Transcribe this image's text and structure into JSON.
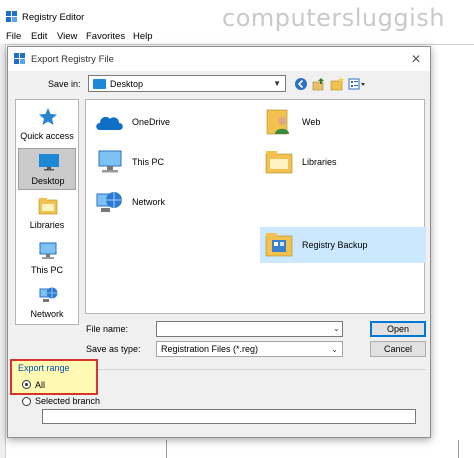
{
  "watermark": "computersluggish",
  "app": {
    "title": "Registry Editor",
    "menu": [
      "File",
      "Edit",
      "View",
      "Favorites",
      "Help"
    ]
  },
  "dialog": {
    "title": "Export Registry File",
    "close_glyph": "✕",
    "save_in": {
      "label": "Save in:",
      "value": "Desktop"
    },
    "places": [
      {
        "label": "Quick access",
        "icon": "star-icon"
      },
      {
        "label": "Desktop",
        "icon": "desktop-icon",
        "selected": true
      },
      {
        "label": "Libraries",
        "icon": "libraries-icon"
      },
      {
        "label": "This PC",
        "icon": "this-pc-icon"
      },
      {
        "label": "Network",
        "icon": "network-icon"
      }
    ],
    "items": [
      {
        "label": "OneDrive",
        "icon": "onedrive-icon"
      },
      {
        "label": "Web",
        "icon": "user-folder-icon"
      },
      {
        "label": "This PC",
        "icon": "this-pc-icon"
      },
      {
        "label": "Libraries",
        "icon": "libraries-folder-icon"
      },
      {
        "label": "Network",
        "icon": "network-icon"
      },
      {
        "label": "Registry Backup",
        "icon": "folder-icon",
        "selected": true
      }
    ],
    "file_name": {
      "label": "File name:",
      "value": ""
    },
    "save_as_type": {
      "label": "Save as type:",
      "value": "Registration Files (*.reg)"
    },
    "buttons": {
      "open": "Open",
      "cancel": "Cancel"
    },
    "export_range": {
      "title": "Export range",
      "all": "All",
      "selected_branch": "Selected branch",
      "selected_option": "All",
      "branch_value": ""
    },
    "highlight_color": "#d9342b"
  }
}
